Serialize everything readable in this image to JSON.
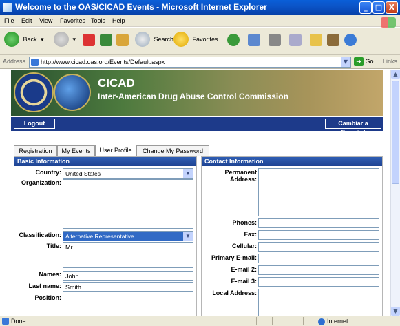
{
  "window": {
    "title": "Welcome to the OAS/CICAD Events - Microsoft Internet Explorer",
    "minimize": "_",
    "maximize": "□",
    "close": "X"
  },
  "menu": [
    "File",
    "Edit",
    "View",
    "Favorites",
    "Tools",
    "Help"
  ],
  "toolbar": {
    "back": "Back",
    "search": "Search",
    "favorites": "Favorites"
  },
  "address": {
    "label": "Address",
    "url": "http://www.cicad.oas.org/Events/Default.aspx",
    "go": "Go",
    "links": "Links"
  },
  "banner": {
    "title": "CICAD",
    "subtitle": "Inter-American Drug Abuse Control Commission"
  },
  "nav": {
    "logout": "Logout",
    "language": "Cambiar a Español"
  },
  "tabs": [
    "Registration",
    "My Events",
    "User Profile",
    "Change My Password"
  ],
  "basic": {
    "header": "Basic Information",
    "country_label": "Country:",
    "country_value": "United States",
    "organization_label": "Organization:",
    "classification_label": "Classification:",
    "classification_value": "Alternative Representative",
    "title_label": "Title:",
    "title_value": "Mr.",
    "names_label": "Names:",
    "names_value": "John",
    "lastname_label": "Last name:",
    "lastname_value": "Smith",
    "position_label": "Position:"
  },
  "contact": {
    "header": "Contact Information",
    "permanent_label_1": "Permanent",
    "permanent_label_2": "Address:",
    "phones_label": "Phones:",
    "fax_label": "Fax:",
    "cellular_label": "Cellular:",
    "primary_email_label": "Primary E-mail:",
    "email2_label": "E-mail 2:",
    "email3_label": "E-mail 3:",
    "local_label": "Local Address:"
  },
  "status": {
    "text": "Done",
    "zone": "Internet"
  },
  "colors": {
    "titlebar": "#0b54c8",
    "panel_header": "#1e4393",
    "banner_bar": "#1d3a8a"
  }
}
